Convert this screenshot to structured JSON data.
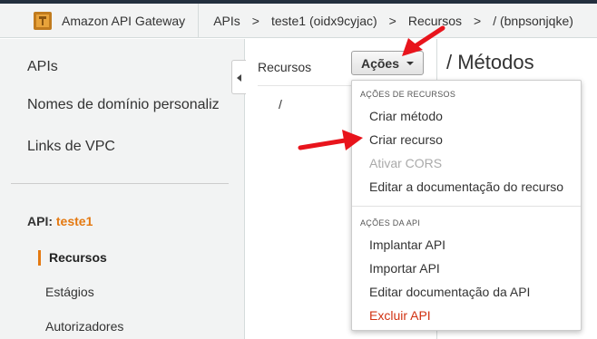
{
  "navbar": {
    "brand": "Amazon API Gateway",
    "breadcrumbs": [
      "APIs",
      "teste1 (oidx9cyjac)",
      "Recursos",
      "/ (bnpsonjqke)"
    ],
    "separator": ">"
  },
  "sidebar": {
    "links": [
      "APIs",
      "Nomes de domínio personaliz",
      "Links de VPC"
    ],
    "api_label": "API:",
    "api_name": "teste1",
    "sub_items": [
      "Recursos",
      "Estágios",
      "Autorizadores"
    ]
  },
  "resources": {
    "header": "Recursos",
    "root": "/"
  },
  "actions_button": {
    "label": "Ações"
  },
  "methods_title": "/ Métodos",
  "menu": {
    "resource_header": "AÇÕES DE RECURSOS",
    "resource_items": [
      "Criar método",
      "Criar recurso",
      "Ativar CORS",
      "Editar a documentação do recurso"
    ],
    "api_header": "AÇÕES DA API",
    "api_items": [
      "Implantar API",
      "Importar API",
      "Editar documentação da API",
      "Excluir API"
    ]
  },
  "colors": {
    "accent": "#e47911",
    "danger": "#d13212",
    "annotation_arrow": "#e8141c"
  }
}
